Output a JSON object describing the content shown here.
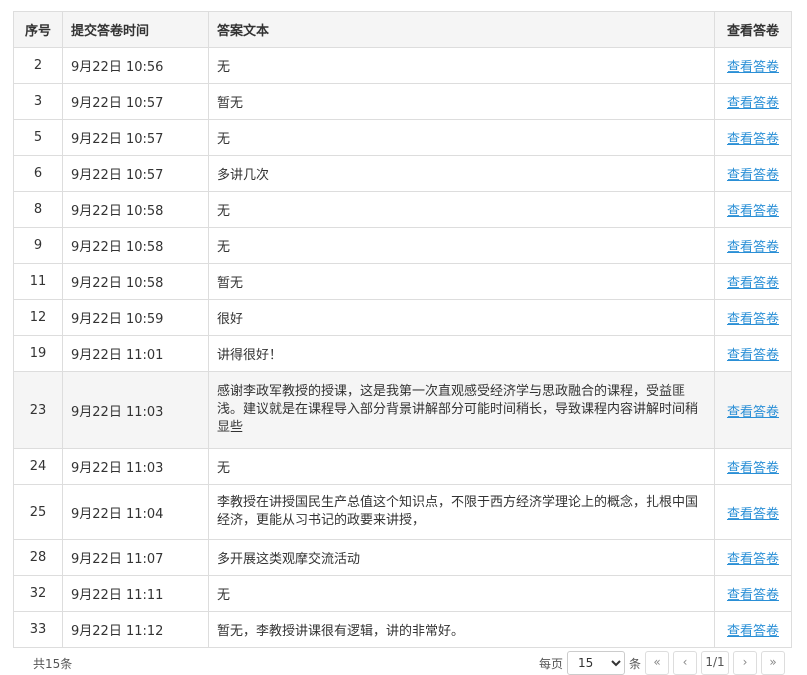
{
  "table": {
    "headers": [
      "序号",
      "提交答卷时间",
      "答案文本",
      "查看答卷"
    ],
    "rows": [
      {
        "seq": "2",
        "time": "9月22日 10:56",
        "answer": "无",
        "link": "查看答卷"
      },
      {
        "seq": "3",
        "time": "9月22日 10:57",
        "answer": "暂无",
        "link": "查看答卷"
      },
      {
        "seq": "5",
        "time": "9月22日 10:57",
        "answer": "无",
        "link": "查看答卷"
      },
      {
        "seq": "6",
        "time": "9月22日 10:57",
        "answer": "多讲几次",
        "link": "查看答卷"
      },
      {
        "seq": "8",
        "time": "9月22日 10:58",
        "answer": "无",
        "link": "查看答卷"
      },
      {
        "seq": "9",
        "time": "9月22日 10:58",
        "answer": "无",
        "link": "查看答卷"
      },
      {
        "seq": "11",
        "time": "9月22日 10:58",
        "answer": "暂无",
        "link": "查看答卷"
      },
      {
        "seq": "12",
        "time": "9月22日 10:59",
        "answer": "很好",
        "link": "查看答卷"
      },
      {
        "seq": "19",
        "time": "9月22日 11:01",
        "answer": "讲得很好！",
        "link": "查看答卷"
      },
      {
        "seq": "23",
        "time": "9月22日 11:03",
        "answer": "感谢李政军教授的授课，这是我第一次直观感受经济学与思政融合的课程，受益匪浅。建议就是在课程导入部分背景讲解部分可能时间稍长，导致课程内容讲解时间稍显些",
        "link": "查看答卷"
      },
      {
        "seq": "24",
        "time": "9月22日 11:03",
        "answer": "无",
        "link": "查看答卷"
      },
      {
        "seq": "25",
        "time": "9月22日 11:04",
        "answer": "李教授在讲授国民生产总值这个知识点，不限于西方经济学理论上的概念，扎根中国经济，更能从习书记的政要来讲授，",
        "link": "查看答卷"
      },
      {
        "seq": "28",
        "time": "9月22日 11:07",
        "answer": "多开展这类观摩交流活动",
        "link": "查看答卷"
      },
      {
        "seq": "32",
        "time": "9月22日 11:11",
        "answer": "无",
        "link": "查看答卷"
      },
      {
        "seq": "33",
        "time": "9月22日 11:12",
        "answer": "暂无，李教授讲课很有逻辑，讲的非常好。",
        "link": "查看答卷"
      }
    ]
  },
  "footer": {
    "total": "共15条",
    "per_page_label": "每页",
    "per_page_value": "15",
    "per_page_unit": "条",
    "first_icon": "«",
    "prev_icon": "‹",
    "page_info": "1/1",
    "next_icon": "›",
    "last_icon": "»"
  },
  "colors": {
    "link": "#2a8fd6",
    "header_bg": "#f5f5f5",
    "border": "#dddddd"
  }
}
